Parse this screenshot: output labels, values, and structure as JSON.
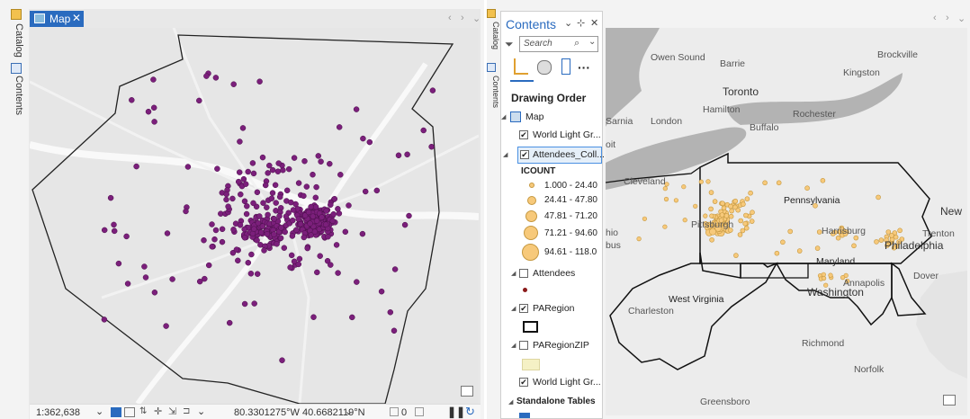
{
  "left": {
    "vtabs": {
      "catalog": "Catalog",
      "contents": "Contents"
    },
    "map_tab": {
      "label": "Map",
      "close": "✕"
    },
    "nav_prev": "‹",
    "nav_next": "›",
    "status": {
      "scale": "1:362,638",
      "coords": "80.3301275°W 40.6682119°N",
      "paused": "0"
    }
  },
  "right": {
    "vtabs": {
      "catalog": "Catalog",
      "contents": "Contents"
    },
    "nav_prev": "‹",
    "nav_next": "›",
    "contents_pane": {
      "title": "Contents",
      "search_placeholder": "Search",
      "drawing_order": "Drawing Order",
      "layers": {
        "map": "Map",
        "world_light_1": "World Light Gr...",
        "attendees_coll": "Attendees_Coll...",
        "icount": "ICOUNT",
        "legend": [
          "1.000 - 24.40",
          "24.41 - 47.80",
          "47.81 - 71.20",
          "71.21 - 94.60",
          "94.61 - 118.0"
        ],
        "attendees": "Attendees",
        "paregion": "PARegion",
        "paregionzip": "PARegionZIP",
        "world_light_2": "World Light Gr...",
        "standalone": "Standalone Tables"
      }
    },
    "cities": {
      "owen_sound": "Owen Sound",
      "barrie": "Barrie",
      "brockville": "Brockville",
      "kingston": "Kingston",
      "toronto": "Toronto",
      "hamilton": "Hamilton",
      "rochester": "Rochester",
      "sarnia": "Sarnia",
      "london": "London",
      "buffalo": "Buffalo",
      "cleveland": "Cleveland",
      "pennsylvania": "Pennsylvania",
      "new": "New",
      "pittsburgh": "Pittsburgh",
      "harrisburg": "Harrisburg",
      "trenton": "Trenton",
      "philadelphia": "Philadelphia",
      "ohio": "hio",
      "bus": "bus",
      "maryland": "Maryland",
      "dover": "Dover",
      "annapolis": "Annapolis",
      "washington": "Washington",
      "west_virginia": "West Virginia",
      "charleston": "Charleston",
      "richmond": "Richmond",
      "norfolk": "Norfolk",
      "greensboro": "Greensboro",
      "oit": "oit",
      "sarnia_short": "Sarnia"
    },
    "colors": {
      "left_point": "#7b1f7b",
      "right_point": "#f7c97a",
      "accent": "#2a6bbf"
    }
  }
}
